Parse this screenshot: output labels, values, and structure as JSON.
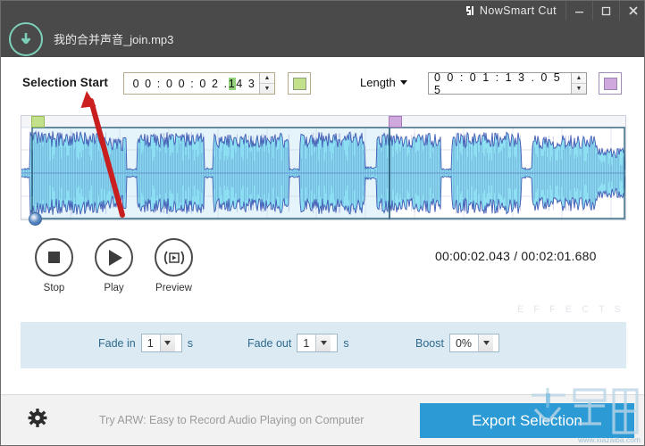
{
  "window": {
    "app_name": "NowSmart Cut",
    "logo_icon": "nowsmart-logo-icon",
    "minimize_label": "–",
    "maximize_label": "☐",
    "close_label": "✕",
    "file_name": "我的合并声音_join.mp3",
    "file_icon": "download-circle-icon",
    "titlebar_bg": "#4a4a4a",
    "icon_color": "#7ecfba"
  },
  "selection": {
    "start_label": "Selection Start",
    "start_value_pre": "0 0 : 0 0 : 0 2 . ",
    "start_value_hl": "1",
    "start_value_post": "4 3",
    "start_value_full": "00:00:02.143",
    "start_swatch_icon": "green-color-swatch",
    "start_swatch_color": "#c3e08a",
    "length_label": "Length",
    "length_caret_icon": "chevron-down-icon",
    "length_value": "0 0 : 0 1 : 1 3 . 0 5 5",
    "length_value_full": "00:01:13.055",
    "length_swatch_icon": "purple-color-swatch",
    "length_swatch_color": "#cfa9de",
    "spinner_up_icon": "spinner-up-arrow",
    "spinner_down_icon": "spinner-down-arrow",
    "spinner_up_glyph": "▲",
    "spinner_down_glyph": "▼"
  },
  "waveform": {
    "start_marker_icon": "selection-start-marker",
    "end_marker_icon": "selection-end-marker",
    "scrub_handle_icon": "playhead-handle",
    "wave_color": "#3b54b0",
    "selection_fill": "#7fdcf0",
    "background": "#f3f5f9",
    "annotation_icon": "red-arrow-annotation",
    "annotation_color": "#cc2222"
  },
  "transport": {
    "buttons": [
      {
        "label": "Stop",
        "icon": "stop-icon"
      },
      {
        "label": "Play",
        "icon": "play-icon"
      },
      {
        "label": "Preview",
        "icon": "preview-icon"
      }
    ],
    "time_current": "00:00:02.043",
    "time_separator": " / ",
    "time_total": "00:02:01.680",
    "time_display": "00:00:02.043 / 00:02:01.680"
  },
  "effects": {
    "watermark": "E F F E C T S",
    "fade_in_label": "Fade in",
    "fade_in_value": "1",
    "fade_in_unit": "s",
    "fade_out_label": "Fade out",
    "fade_out_value": "1",
    "fade_out_unit": "s",
    "boost_label": "Boost",
    "boost_value": "0%",
    "dropdown_icon": "dropdown-arrow-icon",
    "dropdown_glyph": "▼",
    "panel_color": "#dceaf4"
  },
  "bottom": {
    "settings_icon": "gear-icon",
    "promo_text": "Try ARW: Easy to Record Audio Playing on Computer",
    "export_label": "Export Selection",
    "export_color": "#2c9ad4",
    "watermark_url": "www.xiazaiba.com"
  }
}
